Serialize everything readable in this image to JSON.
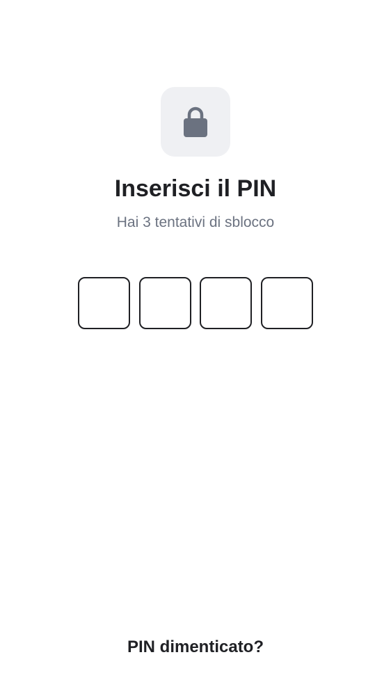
{
  "lock": {
    "icon": "lock-icon",
    "tile_color": "#eff0f3",
    "icon_color": "#6b7280"
  },
  "header": {
    "title": "Inserisci il PIN",
    "subtitle": "Hai 3 tentativi di sblocco"
  },
  "pin": {
    "digits": [
      "",
      "",
      "",
      ""
    ]
  },
  "footer": {
    "forgot_label": "PIN dimenticato?"
  },
  "colors": {
    "text": "#1f2024",
    "muted": "#6b7280",
    "background": "#ffffff"
  }
}
